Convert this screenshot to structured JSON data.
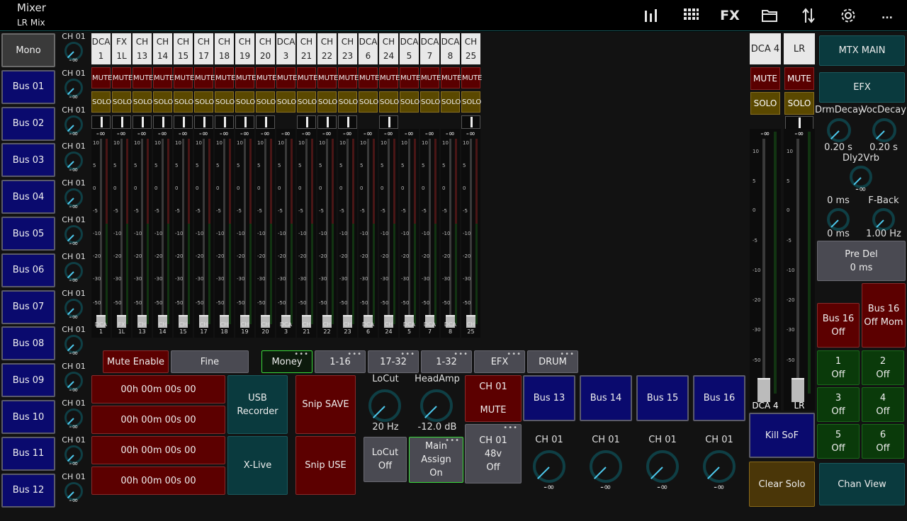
{
  "header": {
    "title": "Mixer",
    "subtitle": "LR Mix",
    "fx_label": "FX",
    "more_label": "...",
    "icons": [
      "meters-icon",
      "grid-icon",
      "fx-icon",
      "folder-icon",
      "routing-icon",
      "gear-icon",
      "more-icon"
    ]
  },
  "bus_buttons": [
    "Mono",
    "Bus 01",
    "Bus 02",
    "Bus 03",
    "Bus 04",
    "Bus 05",
    "Bus 06",
    "Bus 07",
    "Bus 08",
    "Bus 09",
    "Bus 10",
    "Bus 11",
    "Bus 12"
  ],
  "send_source": "CH 01",
  "send_value": "-∞",
  "channels": [
    {
      "top": "DCA",
      "num": "1",
      "pan": true
    },
    {
      "top": "FX",
      "num": "1L",
      "pan": true
    },
    {
      "top": "CH",
      "num": "13",
      "pan": true
    },
    {
      "top": "CH",
      "num": "14",
      "pan": true
    },
    {
      "top": "CH",
      "num": "15",
      "pan": true
    },
    {
      "top": "CH",
      "num": "17",
      "pan": true
    },
    {
      "top": "CH",
      "num": "18",
      "pan": true
    },
    {
      "top": "CH",
      "num": "19",
      "pan": true
    },
    {
      "top": "CH",
      "num": "20",
      "pan": true
    },
    {
      "top": "DCA",
      "num": "3",
      "pan": false
    },
    {
      "top": "CH",
      "num": "21",
      "pan": true
    },
    {
      "top": "CH",
      "num": "22",
      "pan": true
    },
    {
      "top": "CH",
      "num": "23",
      "pan": true
    },
    {
      "top": "DCA",
      "num": "6",
      "pan": false
    },
    {
      "top": "CH",
      "num": "24",
      "pan": true
    },
    {
      "top": "DCA",
      "num": "5",
      "pan": false
    },
    {
      "top": "DCA",
      "num": "7",
      "pan": false
    },
    {
      "top": "DCA",
      "num": "8",
      "pan": false
    },
    {
      "top": "CH",
      "num": "25",
      "pan": true
    }
  ],
  "strip": {
    "mute": "MUTE",
    "solo": "SOLO",
    "fader_value": "-∞",
    "scale": [
      "10",
      "5",
      "0",
      "-5",
      "-10",
      "-20",
      "-30",
      "-50"
    ],
    "big_scale": [
      "10",
      "5",
      "0",
      "-5",
      "-10",
      "-20",
      "-30",
      "-50"
    ]
  },
  "masters": [
    {
      "label": "DCA 4",
      "bottom": "DCA 4",
      "value": "-∞"
    },
    {
      "label": "LR",
      "bottom": "LR",
      "value": "-∞"
    }
  ],
  "toolbar": {
    "mute_enable": "Mute Enable",
    "fine": "Fine",
    "tabs": [
      "Money",
      "1-16",
      "17-32",
      "1-32",
      "EFX",
      "DRUM"
    ],
    "active_tab": "Money"
  },
  "timers": [
    "00h 00m 00s 00",
    "00h 00m 00s 00",
    "00h 00m 00s 00",
    "00h 00m 00s 00"
  ],
  "recorder": {
    "usb": "USB\nRecorder",
    "xlive": "X-Live"
  },
  "snips": {
    "save": "Snip SAVE",
    "use": "Snip USE"
  },
  "locut": {
    "label": "LoCut",
    "value": "20 Hz",
    "button_title": "LoCut",
    "button_state": "Off"
  },
  "headamp": {
    "label": "HeadAmp",
    "value": "-12.0 dB"
  },
  "channel_mute": {
    "title": "CH 01",
    "state": "MUTE"
  },
  "main_assign": {
    "title": "Main Assign",
    "state": "On"
  },
  "phantom": {
    "title": "CH 01",
    "sub": "48v",
    "state": "Off"
  },
  "bus_sends": [
    {
      "label": "Bus 13",
      "source": "CH 01",
      "value": "-∞"
    },
    {
      "label": "Bus 14",
      "source": "CH 01",
      "value": "-∞"
    },
    {
      "label": "Bus 15",
      "source": "CH 01",
      "value": "-∞"
    },
    {
      "label": "Bus 16",
      "source": "CH 01",
      "value": "-∞"
    }
  ],
  "right_panel": {
    "mtx_main": "MTX MAIN",
    "efx": "EFX",
    "drm_decay": {
      "label": "DrmDecay",
      "value": "0.20 s"
    },
    "voc_decay": {
      "label": "VocDecay",
      "value": "0.20 s"
    },
    "dly2vrb": {
      "label": "Dly2Vrb",
      "value": "-∞"
    },
    "delay_a": {
      "label": "0 ms",
      "value": "0 ms"
    },
    "fback": {
      "label": "F-Back",
      "value": "1.00 Hz"
    },
    "pre_del": {
      "title": "Pre Del",
      "value": "0 ms"
    },
    "bus16_off": {
      "title": "Bus 16",
      "state": "Off"
    },
    "bus16_mom": {
      "title": "Bus 16",
      "state": "Off Mom"
    },
    "mute_groups": [
      {
        "num": "1",
        "state": "Off"
      },
      {
        "num": "2",
        "state": "Off"
      },
      {
        "num": "3",
        "state": "Off"
      },
      {
        "num": "4",
        "state": "Off"
      },
      {
        "num": "5",
        "state": "Off"
      },
      {
        "num": "6",
        "state": "Off"
      }
    ],
    "kill_sof": "Kill SoF",
    "clear_solo": "Clear Solo",
    "chan_view": "Chan View"
  },
  "colors": {
    "accent": "#4dc8ec",
    "mute": "#5c0000",
    "solo": "#5a4800",
    "bus": "#0a0a6e",
    "group": "#0a3a0a",
    "active_tab_border": "#3adb3a"
  }
}
